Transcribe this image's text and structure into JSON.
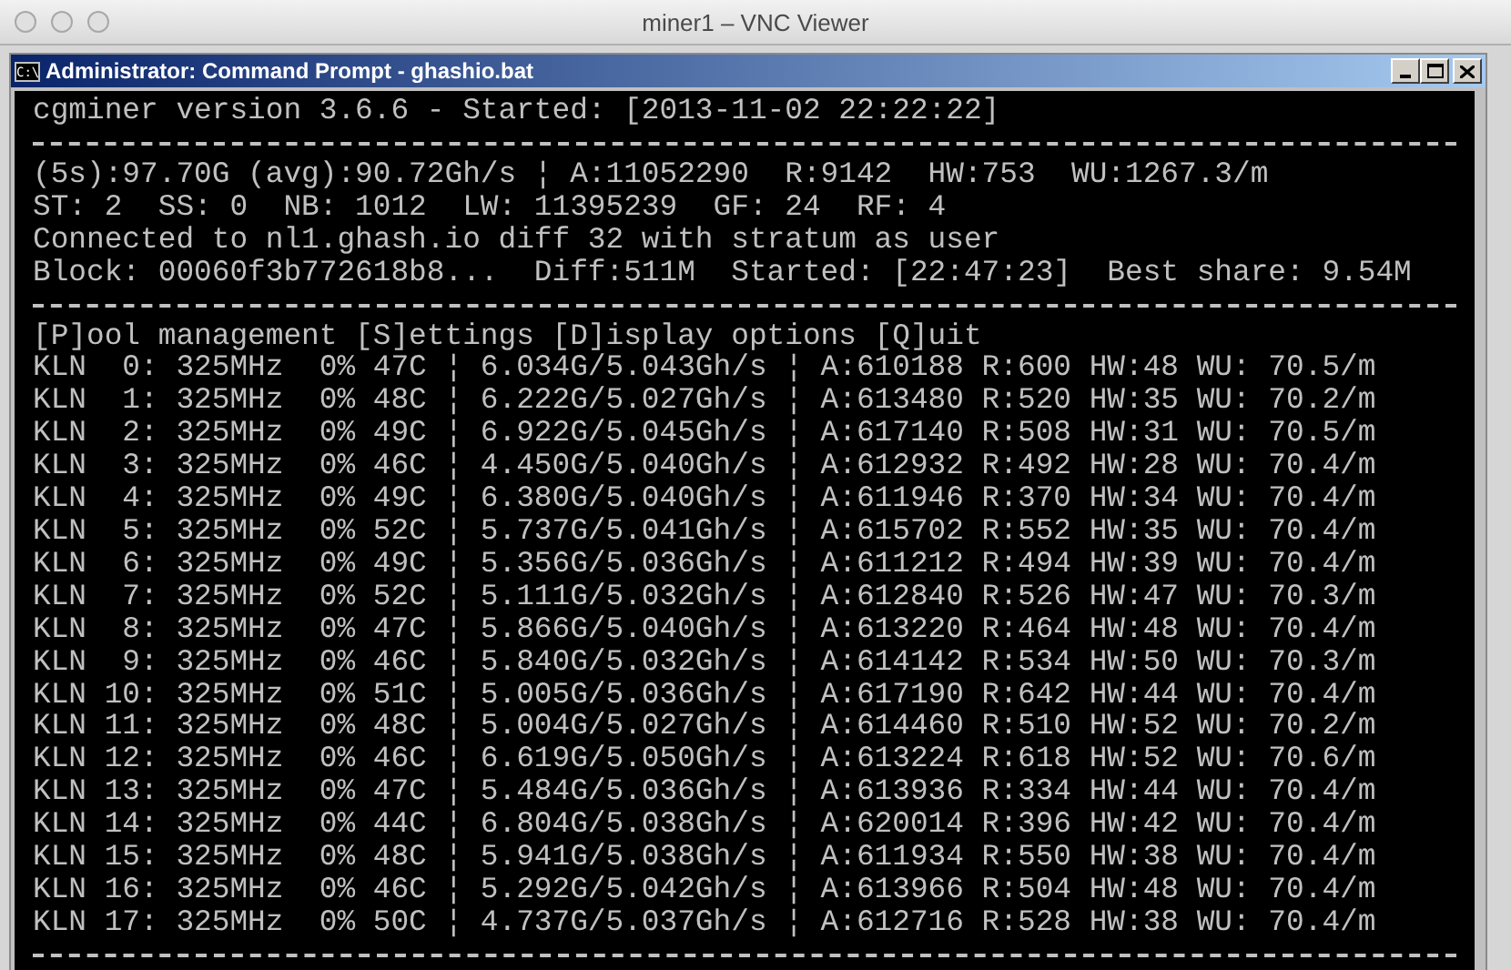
{
  "window": {
    "title": "miner1 – VNC Viewer"
  },
  "console_window": {
    "title": "Administrator: Command Prompt - ghashio.bat",
    "icon_text": "C:\\"
  },
  "console": {
    "header": "cgminer version 3.6.6 - Started: [2013-11-02 22:22:22]",
    "status_lines": [
      "(5s):97.70G (avg):90.72Gh/s ¦ A:11052290  R:9142  HW:753  WU:1267.3/m",
      "ST: 2  SS: 0  NB: 1012  LW: 11395239  GF: 24  RF: 4",
      "Connected to nl1.ghash.io diff 32 with stratum as user",
      "Block: 00060f3b772618b8...  Diff:511M  Started: [22:47:23]  Best share: 9.54M"
    ],
    "menu": "[P]ool management [S]ettings [D]isplay options [Q]uit",
    "device_lines": [
      "KLN  0: 325MHz  0% 47C ¦ 6.034G/5.043Gh/s ¦ A:610188 R:600 HW:48 WU: 70.5/m",
      "KLN  1: 325MHz  0% 48C ¦ 6.222G/5.027Gh/s ¦ A:613480 R:520 HW:35 WU: 70.2/m",
      "KLN  2: 325MHz  0% 49C ¦ 6.922G/5.045Gh/s ¦ A:617140 R:508 HW:31 WU: 70.5/m",
      "KLN  3: 325MHz  0% 46C ¦ 4.450G/5.040Gh/s ¦ A:612932 R:492 HW:28 WU: 70.4/m",
      "KLN  4: 325MHz  0% 49C ¦ 6.380G/5.040Gh/s ¦ A:611946 R:370 HW:34 WU: 70.4/m",
      "KLN  5: 325MHz  0% 52C ¦ 5.737G/5.041Gh/s ¦ A:615702 R:552 HW:35 WU: 70.4/m",
      "KLN  6: 325MHz  0% 49C ¦ 5.356G/5.036Gh/s ¦ A:611212 R:494 HW:39 WU: 70.4/m",
      "KLN  7: 325MHz  0% 52C ¦ 5.111G/5.032Gh/s ¦ A:612840 R:526 HW:47 WU: 70.3/m",
      "KLN  8: 325MHz  0% 47C ¦ 5.866G/5.040Gh/s ¦ A:613220 R:464 HW:48 WU: 70.4/m",
      "KLN  9: 325MHz  0% 46C ¦ 5.840G/5.032Gh/s ¦ A:614142 R:534 HW:50 WU: 70.3/m",
      "KLN 10: 325MHz  0% 51C ¦ 5.005G/5.036Gh/s ¦ A:617190 R:642 HW:44 WU: 70.4/m",
      "KLN 11: 325MHz  0% 48C ¦ 5.004G/5.027Gh/s ¦ A:614460 R:510 HW:52 WU: 70.2/m",
      "KLN 12: 325MHz  0% 46C ¦ 6.619G/5.050Gh/s ¦ A:613224 R:618 HW:52 WU: 70.6/m",
      "KLN 13: 325MHz  0% 47C ¦ 5.484G/5.036Gh/s ¦ A:613936 R:334 HW:44 WU: 70.4/m",
      "KLN 14: 325MHz  0% 44C ¦ 6.804G/5.038Gh/s ¦ A:620014 R:396 HW:42 WU: 70.4/m",
      "KLN 15: 325MHz  0% 48C ¦ 5.941G/5.038Gh/s ¦ A:611934 R:550 HW:38 WU: 70.4/m",
      "KLN 16: 325MHz  0% 46C ¦ 5.292G/5.042Gh/s ¦ A:613966 R:504 HW:48 WU: 70.4/m",
      "KLN 17: 325MHz  0% 50C ¦ 4.737G/5.037Gh/s ¦ A:612716 R:528 HW:38 WU: 70.4/m"
    ]
  }
}
